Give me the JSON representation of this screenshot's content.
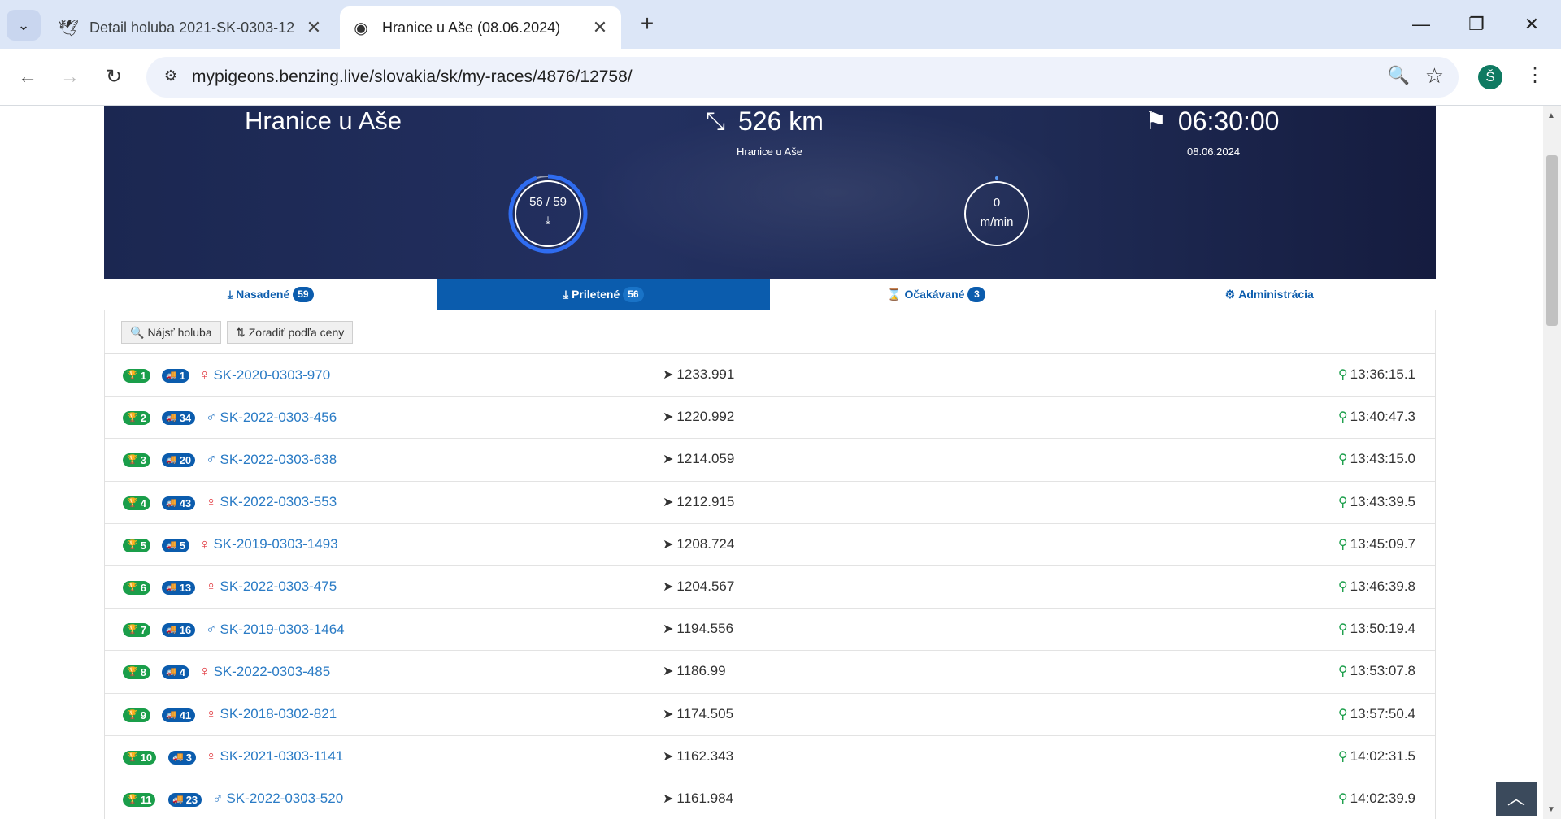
{
  "browser": {
    "tabs": [
      {
        "title": "Detail holuba 2021-SK-0303-12",
        "icon": "dove-icon"
      },
      {
        "title": "Hranice u Aše (08.06.2024)",
        "icon": "pigeon-logo-icon"
      }
    ],
    "url": "mypigeons.benzing.live/slovakia/sk/my-races/4876/12758/",
    "profile_initial": "Š"
  },
  "hero": {
    "title": "Hranice u Aše",
    "distance": "526 km",
    "distance_sub": "Hranice u Aše",
    "release_time": "06:30:00",
    "date": "08.06.2024",
    "progress_text": "56 / 59",
    "progress_fraction": 0.949,
    "speed_value": "0",
    "speed_unit": "m/min"
  },
  "tabs": [
    {
      "label": "Nasadené",
      "count": "59",
      "icon": "basket-icon"
    },
    {
      "label": "Prilетené",
      "count": "56",
      "icon": "landing-icon"
    },
    {
      "label": "Očakávané",
      "count": "3",
      "icon": "hourglass-icon"
    },
    {
      "label": "Administrácia",
      "count": "",
      "icon": "cogs-icon"
    }
  ],
  "actions": {
    "find_label": "Nájsť holuba",
    "sort_label": "Zoradiť podľa ceny"
  },
  "results": [
    {
      "rank": "1",
      "pos": "1",
      "sex": "♀",
      "ring": "SK-2020-0303-970",
      "speed": "1233.991",
      "time": "13:36:15.1"
    },
    {
      "rank": "2",
      "pos": "34",
      "sex": "♂",
      "ring": "SK-2022-0303-456",
      "speed": "1220.992",
      "time": "13:40:47.3"
    },
    {
      "rank": "3",
      "pos": "20",
      "sex": "♂",
      "ring": "SK-2022-0303-638",
      "speed": "1214.059",
      "time": "13:43:15.0"
    },
    {
      "rank": "4",
      "pos": "43",
      "sex": "♀",
      "ring": "SK-2022-0303-553",
      "speed": "1212.915",
      "time": "13:43:39.5"
    },
    {
      "rank": "5",
      "pos": "5",
      "sex": "♀",
      "ring": "SK-2019-0303-1493",
      "speed": "1208.724",
      "time": "13:45:09.7"
    },
    {
      "rank": "6",
      "pos": "13",
      "sex": "♀",
      "ring": "SK-2022-0303-475",
      "speed": "1204.567",
      "time": "13:46:39.8"
    },
    {
      "rank": "7",
      "pos": "16",
      "sex": "♂",
      "ring": "SK-2019-0303-1464",
      "speed": "1194.556",
      "time": "13:50:19.4"
    },
    {
      "rank": "8",
      "pos": "4",
      "sex": "♀",
      "ring": "SK-2022-0303-485",
      "speed": "1186.99",
      "time": "13:53:07.8"
    },
    {
      "rank": "9",
      "pos": "41",
      "sex": "♀",
      "ring": "SK-2018-0302-821",
      "speed": "1174.505",
      "time": "13:57:50.4"
    },
    {
      "rank": "10",
      "pos": "3",
      "sex": "♀",
      "ring": "SK-2021-0303-1141",
      "speed": "1162.343",
      "time": "14:02:31.5"
    },
    {
      "rank": "11",
      "pos": "23",
      "sex": "♂",
      "ring": "SK-2022-0303-520",
      "speed": "1161.984",
      "time": "14:02:39.9"
    }
  ],
  "colors": {
    "primary": "#0b5cad",
    "rank_badge": "#1a9e4a",
    "female": "#e0343a",
    "male": "#2d7ac6",
    "hero_bg": "#1f2b55"
  }
}
